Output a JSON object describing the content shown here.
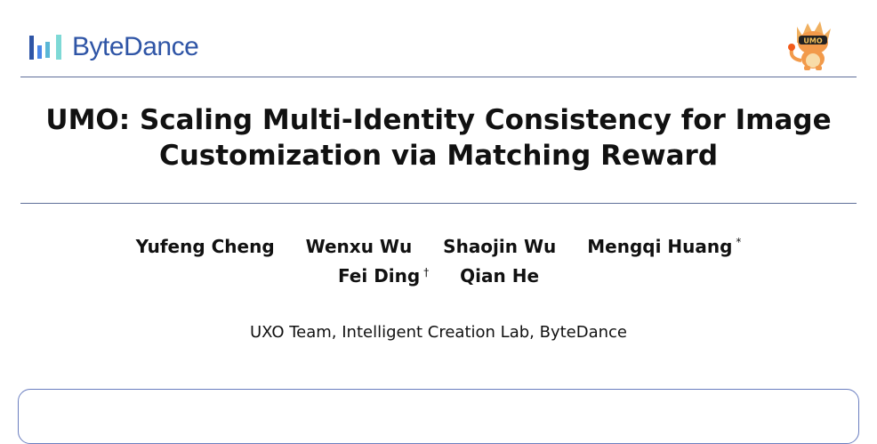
{
  "header": {
    "logo_text": "ByteDance",
    "mascot_label": "UMO"
  },
  "title_lines": [
    "UMO: Scaling Multi-Identity Consistency for Image",
    "Customization via Matching Reward"
  ],
  "authors": [
    {
      "name": "Yufeng Cheng",
      "mark": ""
    },
    {
      "name": "Wenxu Wu",
      "mark": ""
    },
    {
      "name": "Shaojin Wu",
      "mark": ""
    },
    {
      "name": "Mengqi Huang",
      "mark": "*"
    },
    {
      "name": "Fei Ding",
      "mark": "†"
    },
    {
      "name": "Qian He",
      "mark": ""
    }
  ],
  "affiliation": "UXO Team, Intelligent Creation Lab, ByteDance",
  "colors": {
    "brand": "#2f55a6",
    "rule": "#5e6e99",
    "box_border": "#6b7fc0"
  }
}
